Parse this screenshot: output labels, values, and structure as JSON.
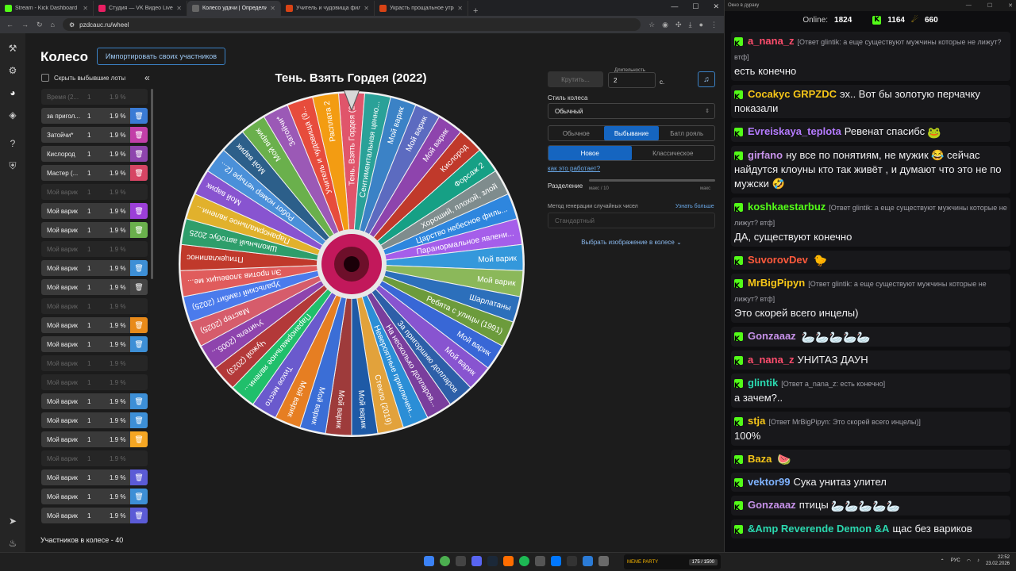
{
  "browser": {
    "tabs": [
      {
        "label": "Stream - Kick Dashboard",
        "color": "#53fc18",
        "active": false
      },
      {
        "label": "Студия — VK Видео Live",
        "color": "#e91e63",
        "active": false
      },
      {
        "label": "Колесо удачи | Определите п...",
        "color": "#666666",
        "active": true
      },
      {
        "label": "Учитель и чудовища фильм, У...",
        "color": "#d84315",
        "active": false
      },
      {
        "label": "Украсть прощальное утро цен...",
        "color": "#d84315",
        "active": false
      }
    ],
    "new_tab": "+",
    "url": "pzdcauc.ru/wheel"
  },
  "app": {
    "title": "Колесо",
    "import_label": "Импортировать своих участников",
    "hide_label": "Скрыть выбывшие лоты",
    "collapse": "«",
    "count_label": "Участников в колесе - 40"
  },
  "participants": [
    {
      "name": "Время (2...",
      "count": "1",
      "pct": "1.9 %",
      "out": true,
      "color": "#3a7bd5"
    },
    {
      "name": "за пригол...",
      "count": "1",
      "pct": "1.9 %",
      "out": false,
      "color": "#3a7bd5"
    },
    {
      "name": "Затойчи*",
      "count": "1",
      "pct": "1.9 %",
      "out": false,
      "color": "#c23fa8"
    },
    {
      "name": "Кислород",
      "count": "1",
      "pct": "1.9 %",
      "out": false,
      "color": "#8e44ad"
    },
    {
      "name": "Мастер (...",
      "count": "1",
      "pct": "1.9 %",
      "out": false,
      "color": "#d64564"
    },
    {
      "name": "Мой варик",
      "count": "1",
      "pct": "1.9 %",
      "out": true,
      "color": "#555"
    },
    {
      "name": "Мой варик",
      "count": "1",
      "pct": "1.9 %",
      "out": false,
      "color": "#9b3fd8"
    },
    {
      "name": "Мой варик",
      "count": "1",
      "pct": "1.9 %",
      "out": false,
      "color": "#6ab04c"
    },
    {
      "name": "Мой варик",
      "count": "1",
      "pct": "1.9 %",
      "out": true,
      "color": "#555"
    },
    {
      "name": "Мой варик",
      "count": "1",
      "pct": "1.9 %",
      "out": false,
      "color": "#3d8fd6"
    },
    {
      "name": "Мой варик",
      "count": "1",
      "pct": "1.9 %",
      "out": false,
      "color": "#444"
    },
    {
      "name": "Мой варик",
      "count": "1",
      "pct": "1.9 %",
      "out": true,
      "color": "#7d2222"
    },
    {
      "name": "Мой варик",
      "count": "1",
      "pct": "1.9 %",
      "out": false,
      "color": "#e88a1a"
    },
    {
      "name": "Мой варик",
      "count": "1",
      "pct": "1.9 %",
      "out": false,
      "color": "#3d8fd6"
    },
    {
      "name": "Мой варик",
      "count": "1",
      "pct": "1.9 %",
      "out": true,
      "color": "#555"
    },
    {
      "name": "Мой варик",
      "count": "1",
      "pct": "1.9 %",
      "out": true,
      "color": "#555"
    },
    {
      "name": "Мой варик",
      "count": "1",
      "pct": "1.9 %",
      "out": false,
      "color": "#3d8fd6"
    },
    {
      "name": "Мой варик",
      "count": "1",
      "pct": "1.9 %",
      "out": false,
      "color": "#3d8fd6"
    },
    {
      "name": "Мой варик",
      "count": "1",
      "pct": "1.9 %",
      "out": false,
      "color": "#f5a623"
    },
    {
      "name": "Мой варик",
      "count": "1",
      "pct": "1.9 %",
      "out": true,
      "color": "#555"
    },
    {
      "name": "Мой варик",
      "count": "1",
      "pct": "1.9 %",
      "out": false,
      "color": "#5b5bd6"
    },
    {
      "name": "Мой варик",
      "count": "1",
      "pct": "1.9 %",
      "out": false,
      "color": "#3d8fd6"
    },
    {
      "name": "Мой варик",
      "count": "1",
      "pct": "1.9 %",
      "out": false,
      "color": "#5b5bd6"
    }
  ],
  "wheel": {
    "title": "Тень. Взять Гордея (2022)",
    "segments": [
      {
        "label": "Тень. Взять Гордея (2...",
        "color": "#e0556b"
      },
      {
        "label": "Сентиментальная ценно...",
        "color": "#2aa198"
      },
      {
        "label": "Мой варик",
        "color": "#3b82c6"
      },
      {
        "label": "Мой варик",
        "color": "#5c6bc0"
      },
      {
        "label": "Мой варик",
        "color": "#8e44ad"
      },
      {
        "label": "Кислород",
        "color": "#c0392b"
      },
      {
        "label": "Форсаж 2",
        "color": "#16a085"
      },
      {
        "label": "Хороший, плохой, злой",
        "color": "#7f8c8d"
      },
      {
        "label": "Царство небесное филь...",
        "color": "#2e86de"
      },
      {
        "label": "Паранормальное явлени...",
        "color": "#a55eea"
      },
      {
        "label": "Мой варик",
        "color": "#3498db"
      },
      {
        "label": "Мой варик",
        "color": "#8bb85a"
      },
      {
        "label": "Шарлатаны",
        "color": "#2c6fbb"
      },
      {
        "label": "Ребята с улицы (1991)",
        "color": "#6c9b3c"
      },
      {
        "label": "Мой варик",
        "color": "#3867d6"
      },
      {
        "label": "Мой варик",
        "color": "#8854d0"
      },
      {
        "label": "За пригоршню долларов",
        "color": "#2d5fa8"
      },
      {
        "label": "На несколько долларов...",
        "color": "#7a3e9d"
      },
      {
        "label": "Невероятные приключен...",
        "color": "#2b8ed6"
      },
      {
        "label": "Стекло (2019)",
        "color": "#e2a23b"
      },
      {
        "label": "Мой варик",
        "color": "#1e5aa6"
      },
      {
        "label": "Мой варик",
        "color": "#9e3b3b"
      },
      {
        "label": "Мой варик",
        "color": "#3b6ed6"
      },
      {
        "label": "Мой варик",
        "color": "#e67e22"
      },
      {
        "label": "Тихое место",
        "color": "#6a5acd"
      },
      {
        "label": "Паранормальное явлени...",
        "color": "#20bf6b"
      },
      {
        "label": "Чужой (2023)",
        "color": "#b33939"
      },
      {
        "label": "Учитель (2005...",
        "color": "#8e44ad"
      },
      {
        "label": "Мастер (2025)",
        "color": "#d65c6b"
      },
      {
        "label": "Уральский гамбит (2025)",
        "color": "#4b7bec"
      },
      {
        "label": "Эл против зловещих ме...",
        "color": "#e05c5c"
      },
      {
        "label": "Птицеклапинос",
        "color": "#c0392b"
      },
      {
        "label": "Школьный автобус 2025",
        "color": "#2e9e6b"
      },
      {
        "label": "Паранормальное явлени...",
        "color": "#e1b12c"
      },
      {
        "label": "Мой варик",
        "color": "#8854d0"
      },
      {
        "label": "Робот номер четыре (2...",
        "color": "#4a90d9"
      },
      {
        "label": "Мой варик",
        "color": "#2c5f8a"
      },
      {
        "label": "Мой варик",
        "color": "#6ab04c"
      },
      {
        "label": "Затойчи*",
        "color": "#9b59b6"
      },
      {
        "label": "Учитель и чудовища (9...",
        "color": "#e74c3c"
      },
      {
        "label": "Расплата 2",
        "color": "#f39c12"
      }
    ]
  },
  "panel": {
    "spin_label": "Крутить...",
    "duration_label": "Длительность",
    "duration_value": "2",
    "duration_unit": "с.",
    "music_icon": "♫",
    "style_label": "Стиль колеса",
    "style_value": "Обычный",
    "modes": [
      "Обычное",
      "Выбывание",
      "Батл рояль"
    ],
    "mode_selected": 1,
    "variants": [
      "Новое",
      "Классическое"
    ],
    "variant_selected": 0,
    "how_link": "как это работает?",
    "separation_label": "Разделение",
    "separation_min": "макс / 10",
    "separation_max": "макс",
    "rng_label": "Метод генерации случайных чисел",
    "rng_link": "Узнать больше",
    "rng_value": "Стандартный",
    "image_select": "Выбрать изображение в колесе"
  },
  "chat": {
    "window_title": "Окно в дураку",
    "online_label": "Online:",
    "online_value": "1824",
    "kick_value": "1164",
    "other_value": "660",
    "messages": [
      {
        "user": "a_nana_z",
        "color": "#ff4d6d",
        "reply": "[Ответ glintik: а еще существуют мужчины которые не лижут? втф]",
        "text": "есть конечно",
        "emote": ""
      },
      {
        "user": "Cocakyc GRPZDC",
        "color": "#f5c518",
        "reply": "",
        "text": "эх.. Вот бы золотую перчачку показали",
        "emote": ""
      },
      {
        "user": "Evreiskaya_teplota",
        "color": "#b57bff",
        "reply": "",
        "text": "Ревенат спасибс",
        "emote": "🐸"
      },
      {
        "user": "girfano",
        "color": "#c792ea",
        "reply": "",
        "text": "ну все по понятиям, не мужик 😂 сейчас найдутся клоуны кто так живёт , и думают что это не по мужски 🤣",
        "emote": ""
      },
      {
        "user": "koshkaestarbuz",
        "color": "#53fc18",
        "reply": "[Ответ glintik: а еще существуют мужчины которые не лижут? втф]",
        "text": "ДА, существуют конечно",
        "emote": ""
      },
      {
        "user": "SuvorovDev",
        "color": "#ff5a3c",
        "reply": "",
        "text": "",
        "emote": "🐤"
      },
      {
        "user": "MrBigPipyn",
        "color": "#f5c518",
        "reply": "[Ответ glintik: а еще существуют мужчины которые не лижут? втф]",
        "text": "Это скорей всего инцелы)",
        "emote": ""
      },
      {
        "user": "Gonzaaaz",
        "color": "#c792ea",
        "reply": "",
        "text": "",
        "emote": "🦢🦢🦢🦢🦢"
      },
      {
        "user": "a_nana_z",
        "color": "#ff4d6d",
        "reply": "",
        "text": "УНИТАЗ ДАУН",
        "emote": ""
      },
      {
        "user": "glintik",
        "color": "#2bd9b0",
        "reply": "[Ответ a_nana_z: есть конечно]",
        "text": "а зачем?..",
        "emote": ""
      },
      {
        "user": "stja",
        "color": "#f5c518",
        "reply": "[Ответ MrBigPipyn: Это скорей всего инцелы)]",
        "text": "100%",
        "emote": ""
      },
      {
        "user": "Baza",
        "color": "#f5c518",
        "reply": "",
        "text": "",
        "emote": "🍉"
      },
      {
        "user": "vektor99",
        "color": "#7fb3ff",
        "reply": "",
        "text": "Сука унитаз улител",
        "emote": ""
      },
      {
        "user": "Gonzaaaz",
        "color": "#c792ea",
        "reply": "",
        "text": "птицы",
        "emote": "🦢🦢🦢🦢🦢"
      },
      {
        "user": "&Amp Reverende Demon &A",
        "color": "#2bd9b0",
        "reply": "",
        "text": "щас без вариков",
        "emote": ""
      }
    ]
  },
  "taskbar": {
    "meme_label": "MEME PARTY",
    "meme_value": "175 / 1500",
    "lang": "РУС",
    "time": "22:52",
    "date": "23.02.2026"
  }
}
